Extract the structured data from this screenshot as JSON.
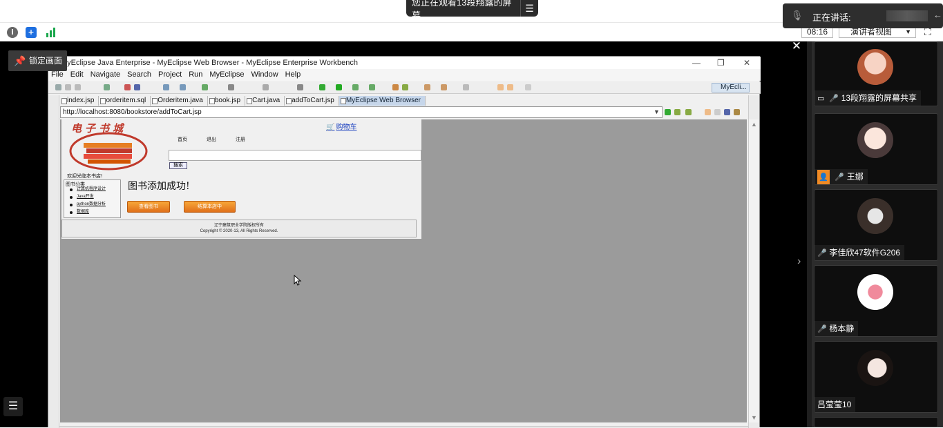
{
  "meeting": {
    "share_banner": "您正在观看13段翔露的屏幕",
    "speaking_label": "正在讲话:",
    "timer": "08:16",
    "view_mode": "演讲者视图",
    "lock_label": "锁定画面"
  },
  "eclipse": {
    "title": "MyEclipse Java Enterprise - MyEclipse Web Browser - MyEclipse Enterprise Workbench",
    "menu": [
      "File",
      "Edit",
      "Navigate",
      "Search",
      "Project",
      "Run",
      "MyEclipse",
      "Window",
      "Help"
    ],
    "perspective": "MyEcli...",
    "tabs": [
      {
        "label": "index.jsp"
      },
      {
        "label": "orderitem.sql"
      },
      {
        "label": "Orderitem.java"
      },
      {
        "label": "book.jsp"
      },
      {
        "label": "Cart.java"
      },
      {
        "label": "addToCart.jsp"
      },
      {
        "label": "MyEclipse Web Browser"
      }
    ],
    "url": "http://localhost:8080/bookstore/addToCart.jsp"
  },
  "webpage": {
    "site_title": "电子书城",
    "cart_link": "购物车",
    "nav": [
      "首页",
      "退出",
      "注册"
    ],
    "search_button": "搜索",
    "welcome": "欢迎光临本书店!",
    "category_title": "图书分类",
    "categories": [
      "计算机程序设计",
      "Java开发",
      "python数据分析",
      "数据库"
    ],
    "added_message": "图书添加成功!",
    "view_books_button": "查看图书",
    "checkout_button": "结算本店中",
    "footer_line1": "辽宁建筑职业学院版权所有",
    "footer_line2": "Copyright © 2020-13, All Rights Reserved."
  },
  "participants": [
    {
      "name": "13段翔露的屏幕共享",
      "mic": "muted",
      "sharing": true
    },
    {
      "name": "王娜",
      "mic": "on"
    },
    {
      "name": "李佳欣47软件G206",
      "mic": "muted"
    },
    {
      "name": "杨本静",
      "mic": "muted"
    },
    {
      "name": "吕莹莹10",
      "mic": "none"
    }
  ]
}
